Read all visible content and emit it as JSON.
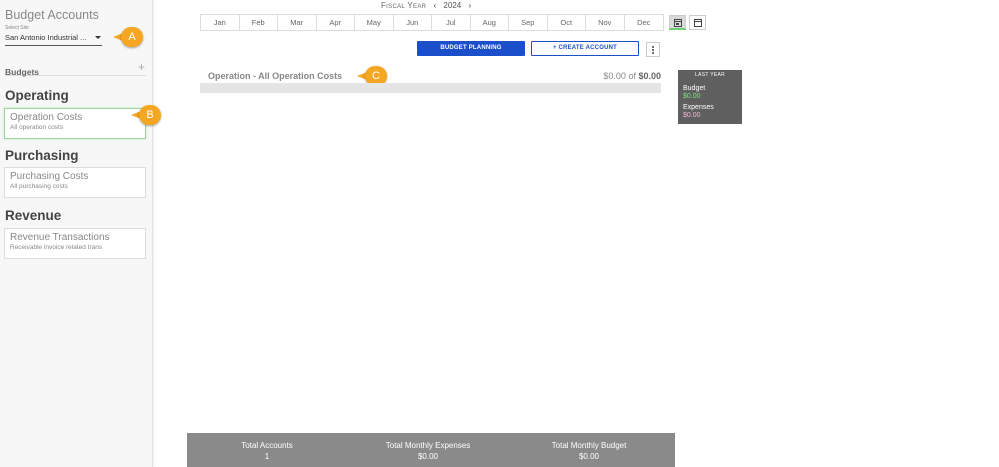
{
  "sidebar": {
    "title": "Budget Accounts",
    "site_label": "Select Site",
    "site_value": "San Antonio Industrial ...",
    "budgets_label": "Budgets",
    "add_symbol": "+",
    "sections": [
      {
        "title": "Operating",
        "card_title": "Operation Costs",
        "card_sub": "All operation costs"
      },
      {
        "title": "Purchasing",
        "card_title": "Purchasing Costs",
        "card_sub": "All purchasing costs"
      },
      {
        "title": "Revenue",
        "card_title": "Revenue Transactions",
        "card_sub": "Receivable invoice related trans"
      }
    ]
  },
  "callouts": [
    "A",
    "B",
    "C"
  ],
  "header": {
    "fiscal_label": "Fiscal Year",
    "prev_arrow": "‹",
    "next_arrow": "›",
    "year": "2024",
    "months": [
      "Jan",
      "Feb",
      "Mar",
      "Apr",
      "May",
      "Jun",
      "Jul",
      "Aug",
      "Sep",
      "Oct",
      "Nov",
      "Dec"
    ]
  },
  "toolbar": {
    "budget_planning_label": "BUDGET PLANNING",
    "create_account_label": "+ CREATE ACCOUNT"
  },
  "account": {
    "name": "Operation - All Operation Costs",
    "spent": "$0.00",
    "of_word": "of",
    "total": "$0.00",
    "progress_fraction": 0
  },
  "last_year": {
    "title": "LAST YEAR",
    "budget_label": "Budget",
    "budget_value": "$0.00",
    "expenses_label": "Expenses",
    "expenses_value": "$0.00"
  },
  "footer": {
    "total_accounts_label": "Total Accounts",
    "total_accounts_value": "1",
    "monthly_expenses_label": "Total Monthly Expenses",
    "monthly_expenses_value": "$0.00",
    "monthly_budget_label": "Total Monthly Budget",
    "monthly_budget_value": "$0.00"
  },
  "colors": {
    "primary": "#1a4fc9",
    "callout": "#f5a623",
    "active_green": "#6fcf6f",
    "footer_bg": "#8a8a8a"
  }
}
